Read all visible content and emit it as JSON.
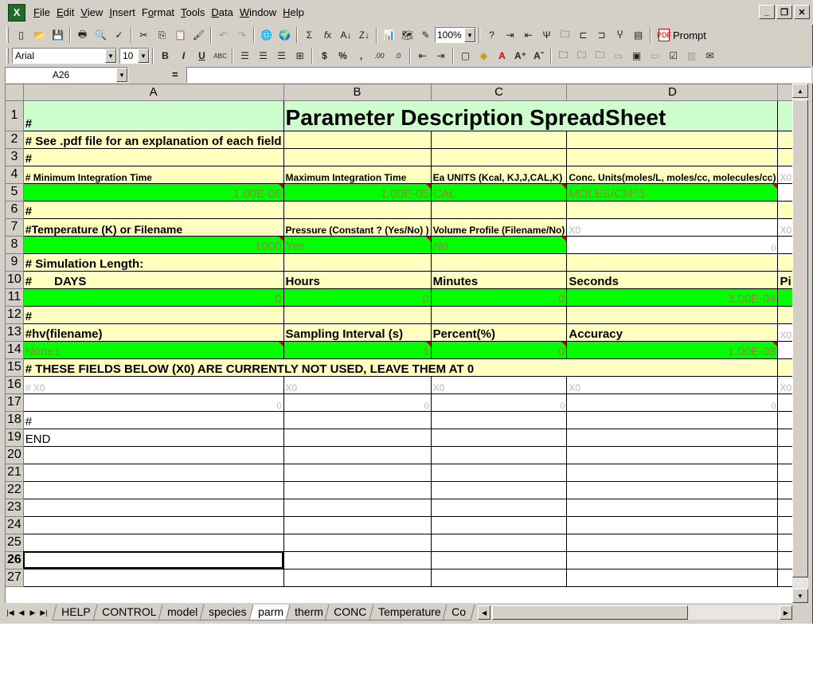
{
  "menu": {
    "items": [
      {
        "label": "File",
        "ul": "F"
      },
      {
        "label": "Edit",
        "ul": "E"
      },
      {
        "label": "View",
        "ul": "V"
      },
      {
        "label": "Insert",
        "ul": "I"
      },
      {
        "label": "Format",
        "ul": "o"
      },
      {
        "label": "Tools",
        "ul": "T"
      },
      {
        "label": "Data",
        "ul": "D"
      },
      {
        "label": "Window",
        "ul": "W"
      },
      {
        "label": "Help",
        "ul": "H"
      }
    ]
  },
  "toolbar": {
    "zoom": "100%",
    "prompt_label": "Prompt",
    "font_name": "Arial",
    "font_size": "10"
  },
  "formula_bar": {
    "name_box": "A26",
    "equals": "="
  },
  "columns": [
    "A",
    "B",
    "C",
    "D"
  ],
  "rows": {
    "r1": {
      "a": "#",
      "title": "Parameter Description SpreadSheet"
    },
    "r2": {
      "a": "# See .pdf file for an explanation of each field"
    },
    "r3": {
      "a": "#"
    },
    "r4": {
      "a": "# Minimum Integration Time",
      "b": "Maximum Integration Time",
      "c": "Ea UNITS (Kcal, KJ,J,CAL,K)",
      "d": "Conc. Units(moles/L, moles/cc, molecules/cc)",
      "e": "X0"
    },
    "r5": {
      "a": "1.00E-06",
      "b": "1.00E-05",
      "c": "CAL",
      "d": "MOLES/CM^3"
    },
    "r6": {
      "a": "#"
    },
    "r7": {
      "a": "#Temperature (K) or Filename",
      "b": "Pressure (Constant ? (Yes/No) )",
      "c": "Volume Profile (Filename/No)",
      "d": "X0",
      "e": "X0"
    },
    "r8": {
      "a": "1000",
      "b": "Yes",
      "c": "No",
      "d": "0"
    },
    "r9": {
      "a": "# Simulation Length:"
    },
    "r10": {
      "a": "#",
      "a2": "DAYS",
      "b": "Hours",
      "c": "Minutes",
      "d": "Seconds",
      "e": "Pi"
    },
    "r11": {
      "a": "0",
      "b": "0",
      "c": "0",
      "d": "3.00E-04"
    },
    "r12": {
      "a": "#"
    },
    "r13": {
      "a": "#hv(filename)",
      "b": "Sampling Interval (s)",
      "c": "Percent(%)",
      "d": "Accuracy",
      "e": "X0"
    },
    "r14": {
      "a": "None1",
      "b": "1",
      "c": "0",
      "d": "1.00E-08"
    },
    "r15": {
      "a": "# THESE FIELDS BELOW (X0) ARE CURRENTLY NOT USED, LEAVE THEM AT 0"
    },
    "r16": {
      "a": "# X0",
      "b": "X0",
      "c": "X0",
      "d": "X0",
      "e": "X0"
    },
    "r17": {
      "a": "0",
      "b": "0",
      "c": "0",
      "d": "0"
    },
    "r18": {
      "a": "#"
    },
    "r19": {
      "a": "END"
    }
  },
  "row_numbers": [
    "1",
    "2",
    "3",
    "4",
    "5",
    "6",
    "7",
    "8",
    "9",
    "10",
    "11",
    "12",
    "13",
    "14",
    "15",
    "16",
    "17",
    "18",
    "19",
    "20",
    "21",
    "22",
    "23",
    "24",
    "25",
    "26",
    "27"
  ],
  "sheet_tabs": [
    "HELP",
    "CONTROL",
    "model",
    "species",
    "parm",
    "therm",
    "CONC",
    "Temperature",
    "Co"
  ],
  "active_tab": "parm"
}
